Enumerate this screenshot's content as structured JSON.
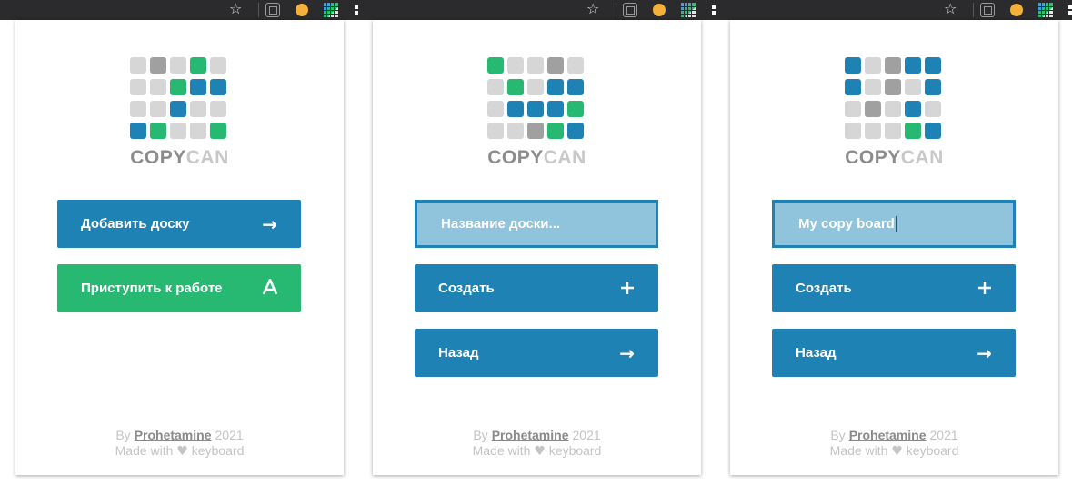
{
  "colors": {
    "blue": "#1f82b5",
    "green": "#27b872",
    "gray": "#a0a0a0",
    "light": "#d6d6d6",
    "input_bg": "#90c3dc"
  },
  "browser": {
    "icons": [
      "bookmark-star-icon",
      "extension-document-icon",
      "extension-sun-icon",
      "extension-grid-icon"
    ]
  },
  "logo": {
    "copy": "COPY",
    "can": "CAN"
  },
  "panels": [
    {
      "grid": [
        [
          "l",
          "g",
          "l",
          "G",
          "l"
        ],
        [
          "l",
          "l",
          "G",
          "b",
          "b"
        ],
        [
          "l",
          "l",
          "b",
          "l",
          "l"
        ],
        [
          "b",
          "G",
          "l",
          "l",
          "G"
        ]
      ],
      "add_board_label": "Добавить доску",
      "start_label": "Приступить к работе"
    },
    {
      "grid": [
        [
          "G",
          "l",
          "l",
          "g",
          "l"
        ],
        [
          "l",
          "G",
          "l",
          "b",
          "b"
        ],
        [
          "l",
          "b",
          "b",
          "b",
          "G"
        ],
        [
          "l",
          "l",
          "g",
          "G",
          "b"
        ]
      ],
      "input_placeholder": "Название доски...",
      "create_label": "Создать",
      "back_label": "Назад"
    },
    {
      "grid": [
        [
          "b",
          "l",
          "g",
          "b",
          "b"
        ],
        [
          "b",
          "l",
          "g",
          "l",
          "b"
        ],
        [
          "l",
          "g",
          "l",
          "b",
          "l"
        ],
        [
          "l",
          "l",
          "l",
          "G",
          "b"
        ]
      ],
      "input_value": "My copy board",
      "create_label": "Создать",
      "back_label": "Назад"
    }
  ],
  "footer": {
    "by": "By",
    "author": "Prohetamine",
    "year": "2021",
    "made_with": "Made with",
    "heart": "♥",
    "keyboard": "keyboard"
  }
}
